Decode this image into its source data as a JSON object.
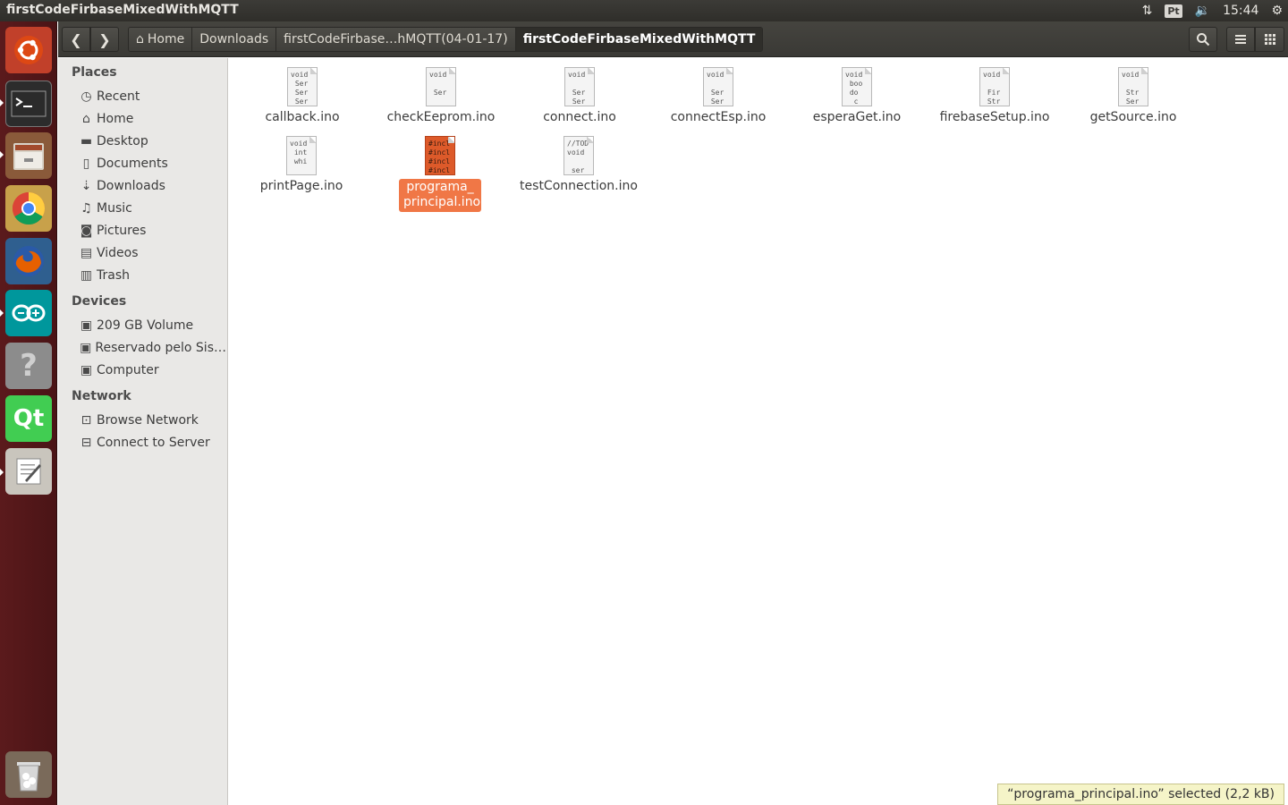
{
  "window": {
    "title": "firstCodeFirbaseMixedWithMQTT"
  },
  "panel": {
    "keyboard": "Pt",
    "time": "15:44"
  },
  "launcher": {
    "items": [
      {
        "name": "ubuntu-dash-icon"
      },
      {
        "name": "terminal-icon"
      },
      {
        "name": "files-icon"
      },
      {
        "name": "chrome-icon"
      },
      {
        "name": "firefox-icon"
      },
      {
        "name": "arduino-icon"
      },
      {
        "name": "help-icon"
      },
      {
        "name": "qt-creator-icon"
      },
      {
        "name": "text-editor-icon"
      },
      {
        "name": "trash-icon"
      }
    ]
  },
  "breadcrumbs": [
    "Home",
    "Downloads",
    "firstCodeFirbase…hMQTT(04-01-17)",
    "firstCodeFirbaseMixedWithMQTT"
  ],
  "sidebar": {
    "places_heading": "Places",
    "places": [
      "Recent",
      "Home",
      "Desktop",
      "Documents",
      "Downloads",
      "Music",
      "Pictures",
      "Videos",
      "Trash"
    ],
    "devices_heading": "Devices",
    "devices": [
      "209 GB Volume",
      "Reservado pelo Sis…",
      "Computer"
    ],
    "network_heading": "Network",
    "network": [
      "Browse Network",
      "Connect to Server"
    ]
  },
  "files": [
    {
      "name": "callback.ino",
      "preview": "void\n Ser\n Ser\n Ser"
    },
    {
      "name": "checkEeprom.ino",
      "preview": "void\n\n Ser"
    },
    {
      "name": "connect.ino",
      "preview": "void\n\n Ser\n Ser"
    },
    {
      "name": "connectEsp.ino",
      "preview": "void\n\n Ser\n Ser"
    },
    {
      "name": "esperaGet.ino",
      "preview": "void\n boo\n do\n  c"
    },
    {
      "name": "firebaseSetup.ino",
      "preview": "void\n\n Fir\n Str"
    },
    {
      "name": "getSource.ino",
      "preview": "void\n\n Str\n Ser"
    },
    {
      "name": "printPage.ino",
      "preview": "void\n int\n whi"
    },
    {
      "name": "programa_ principal.ino",
      "preview": "#incl\n#incl\n#incl\n#incl",
      "selected": true
    },
    {
      "name": "testConnection.ino",
      "preview": "//TOD\nvoid\n\n ser"
    }
  ],
  "status": "“programa_principal.ino” selected  (2,2 kB)"
}
